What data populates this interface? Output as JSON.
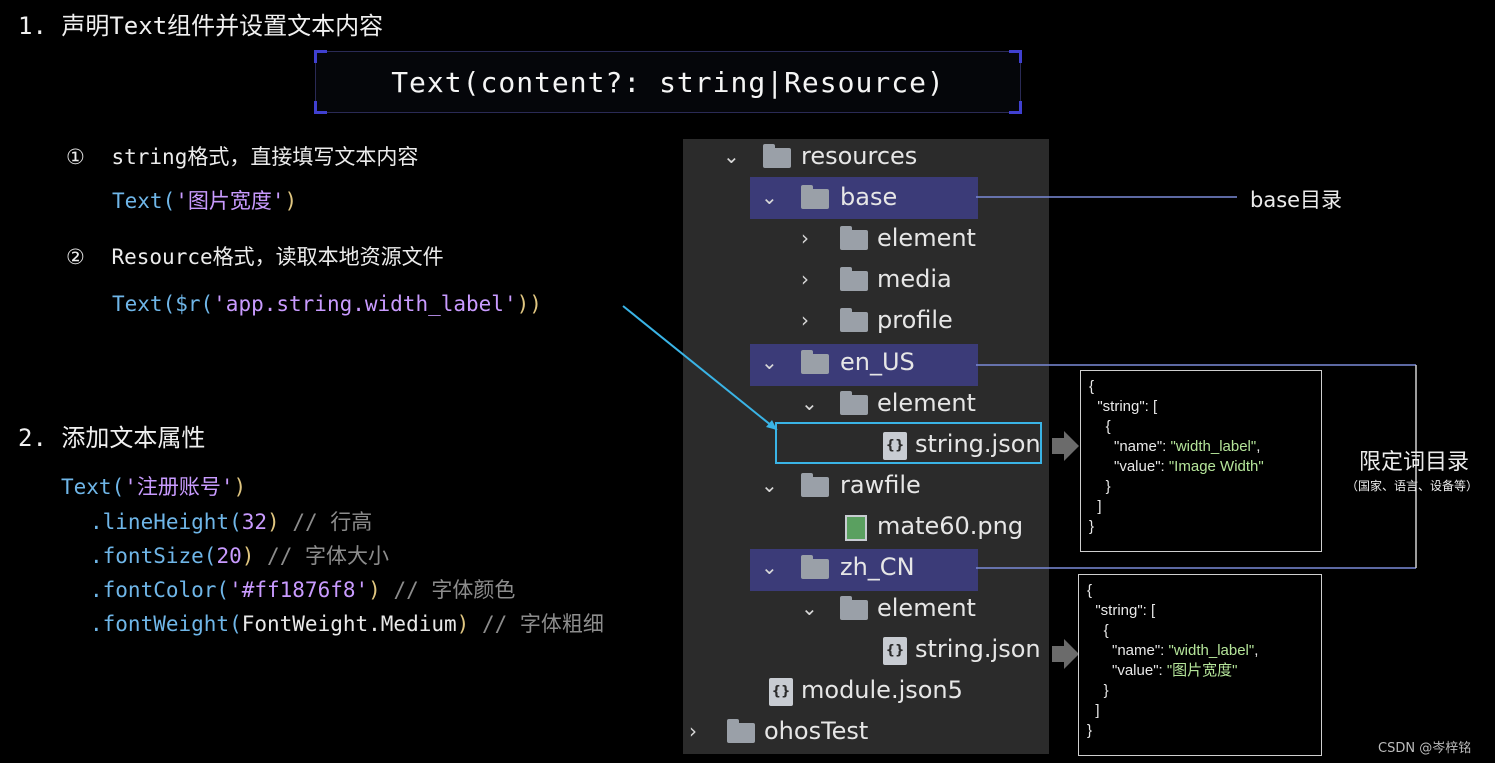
{
  "section1": {
    "title": "1. 声明Text组件并设置文本内容",
    "signature": "Text(content?: string|Resource)",
    "item1": {
      "marker": "①",
      "text": "string格式，直接填写文本内容"
    },
    "code1": {
      "fn": "Text(",
      "arg": "'图片宽度'",
      "close": ")"
    },
    "item2": {
      "marker": "②",
      "text": "Resource格式，读取本地资源文件"
    },
    "code2": {
      "fn": "Text(",
      "r": "$r(",
      "arg": "'app.string.width_label'",
      "close": "))"
    }
  },
  "section2": {
    "title": "2. 添加文本属性",
    "code_head": {
      "fn": "Text(",
      "arg": "'注册账号'",
      "close": ")"
    },
    "lines": [
      {
        "method": ".lineHeight(",
        "value": "32",
        "close": ")",
        "comment": "// 行高"
      },
      {
        "method": ".fontSize(",
        "value": "20",
        "close": ")",
        "comment": "// 字体大小"
      },
      {
        "method": ".fontColor(",
        "value": "'#ff1876f8'",
        "close": ")",
        "comment": "// 字体颜色"
      },
      {
        "method": ".fontWeight(",
        "value": "FontWeight.Medium",
        "close": ")",
        "comment": "// 字体粗细"
      }
    ]
  },
  "tree": {
    "resources": "resources",
    "base": "base",
    "element": "element",
    "media": "media",
    "profile": "profile",
    "en_US": "en_US",
    "element2": "element",
    "string_json_1": "string.json",
    "rawfile": "rawfile",
    "mate60": "mate60.png",
    "zh_CN": "zh_CN",
    "element3": "element",
    "string_json_2": "string.json",
    "module": "module.json5",
    "ohosTest": "ohosTest"
  },
  "annotations": {
    "base_dir": "base目录",
    "qualifier_dir": "限定词目录",
    "qualifier_note": "（国家、语言、设备等）"
  },
  "json_en": {
    "l1": "{",
    "l2": "  \"string\": [",
    "l3": "    {",
    "name_key": "      \"name\": ",
    "name_val": "\"width_label\"",
    "name_comma": ",",
    "value_key": "      \"value\": ",
    "value_val": "\"Image Width\"",
    "l6": "    }",
    "l7": "  ]",
    "l8": "}"
  },
  "json_zh": {
    "l1": "{",
    "l2": "  \"string\": [",
    "l3": "    {",
    "name_key": "      \"name\": ",
    "name_val": "\"width_label\"",
    "name_comma": ",",
    "value_key": "      \"value\": ",
    "value_val": "\"图片宽度\"",
    "l6": "    }",
    "l7": "  ]",
    "l8": "}"
  },
  "watermark": "CSDN @岑梓铭",
  "colors": {
    "highlight": "#3b3b78",
    "selection": "#3ab4e6",
    "code_blue": "#6fb6e8",
    "code_purple": "#c99bff",
    "json_value": "#b5e59a"
  }
}
